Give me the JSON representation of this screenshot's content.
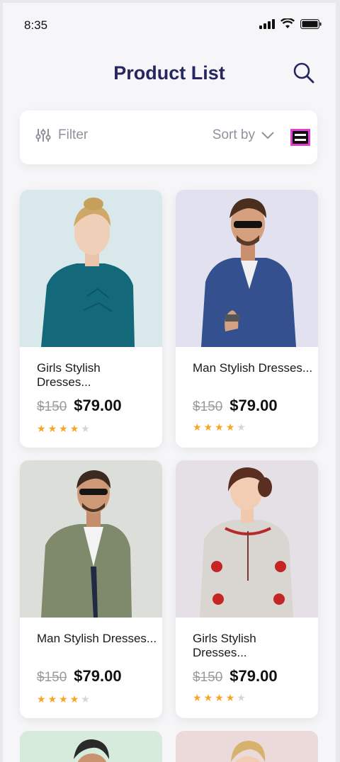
{
  "status_bar": {
    "time": "8:35"
  },
  "header": {
    "title": "Product List"
  },
  "filter_bar": {
    "filter_label": "Filter",
    "sort_label": "Sort by"
  },
  "products": [
    {
      "name": "Girls Stylish Dresses...",
      "old_price": "$150",
      "price": "$79.00",
      "rating": 4,
      "bg": "#d9e8eb"
    },
    {
      "name": "Man Stylish Dresses...",
      "old_price": "$150",
      "price": "$79.00",
      "rating": 4,
      "bg": "#e2e1f0"
    },
    {
      "name": "Man Stylish Dresses...",
      "old_price": "$150",
      "price": "$79.00",
      "rating": 4,
      "bg": "#dcded9"
    },
    {
      "name": "Girls Stylish Dresses...",
      "old_price": "$150",
      "price": "$79.00",
      "rating": 4,
      "bg": "#e4e0e6"
    }
  ],
  "colors": {
    "title": "#262660",
    "star": "#f5a623",
    "accent_toggle": "#e040d0"
  }
}
